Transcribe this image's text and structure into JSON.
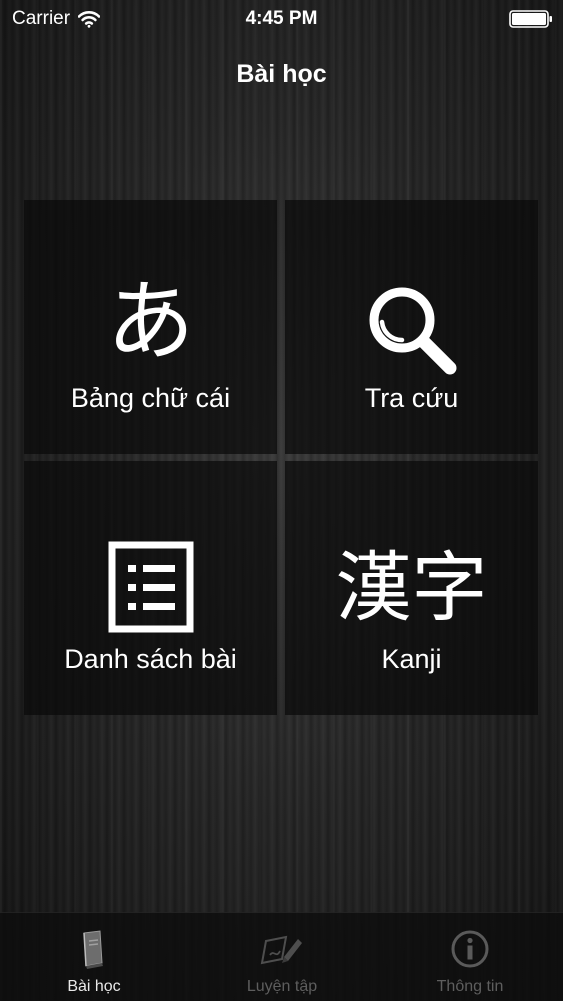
{
  "status_bar": {
    "carrier": "Carrier",
    "time": "4:45 PM",
    "icons": [
      "wifi-icon",
      "battery-icon"
    ]
  },
  "nav": {
    "title": "Bài học"
  },
  "tiles": [
    {
      "glyph": "あ",
      "label": "Bảng chữ cái",
      "icon": "hiragana-a-icon"
    },
    {
      "label": "Tra cứu",
      "icon": "search-icon"
    },
    {
      "label": "Danh sách bài",
      "icon": "list-icon"
    },
    {
      "glyph": "漢字",
      "label": "Kanji",
      "icon": "kanji-icon"
    }
  ],
  "tab_bar": {
    "items": [
      {
        "label": "Bài học",
        "icon": "book-icon",
        "selected": true
      },
      {
        "label": "Luyện tập",
        "icon": "pen-writing-icon",
        "selected": false
      },
      {
        "label": "Thông tin",
        "icon": "info-icon",
        "selected": false
      }
    ]
  },
  "colors": {
    "text": "#ffffff",
    "tile_background": "#0a0a0a",
    "tab_active": "#e8e8e8",
    "tab_inactive": "#5e5e5e"
  }
}
